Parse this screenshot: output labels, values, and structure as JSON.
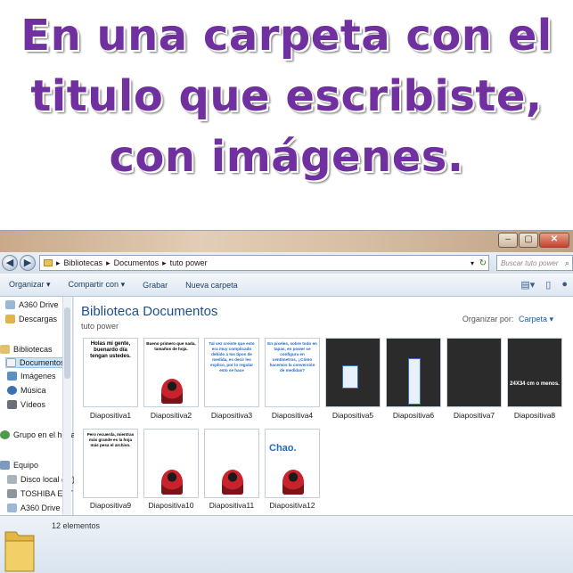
{
  "headline": "En una carpeta con el titulo que escribiste, con imágenes.",
  "window": {
    "controls": [
      "–",
      "▢",
      "✕"
    ]
  },
  "address": {
    "breadcrumbs": [
      "Bibliotecas",
      "Documentos",
      "tuto power"
    ],
    "search_placeholder": "Buscar tuto power"
  },
  "toolbar": {
    "organize": "Organizar ▾",
    "share": "Compartir con ▾",
    "burn": "Grabar",
    "new_folder": "Nueva carpeta"
  },
  "nav": {
    "items": [
      {
        "label": "A360 Drive"
      },
      {
        "label": "Descargas"
      },
      {
        "label": "Bibliotecas"
      },
      {
        "label": "Documentos"
      },
      {
        "label": "Imágenes"
      },
      {
        "label": "Música"
      },
      {
        "label": "Vídeos"
      },
      {
        "label": "Grupo en el hogar"
      },
      {
        "label": "Equipo"
      },
      {
        "label": "Disco local (C:)"
      },
      {
        "label": "TOSHIBA EXT ("
      },
      {
        "label": "A360 Drive"
      }
    ]
  },
  "library": {
    "title": "Biblioteca Documentos",
    "subtitle": "tuto power",
    "arrange_label": "Organizar por:",
    "arrange_value": "Carpeta ▾"
  },
  "files": [
    {
      "name": "Diapositiva1",
      "text": "Holas mi gente, buenardo día tengan ustedes."
    },
    {
      "name": "Diapositiva2",
      "text": "Bueno primero que nada, tamaños de hoja."
    },
    {
      "name": "Diapositiva3",
      "text": "Tal vez creiste que esto era muy complicado debido a los tipos de medida, es decir les explico, por lo regular esto se hace"
    },
    {
      "name": "Diapositiva4",
      "text": "En pixeles, sobre todo en tapas, en power se configura en centímetros, ¿Cómo hacemos la conversión de medidas?"
    },
    {
      "name": "Diapositiva5",
      "text": ""
    },
    {
      "name": "Diapositiva6",
      "text": ""
    },
    {
      "name": "Diapositiva7",
      "text": ""
    },
    {
      "name": "Diapositiva8",
      "text": "24X34 cm o menos."
    },
    {
      "name": "Diapositiva9",
      "text": "Pero recuerda, mientras más grande es la hoja más pesa el archivo."
    },
    {
      "name": "Diapositiva10",
      "text": ""
    },
    {
      "name": "Diapositiva11",
      "text": ""
    },
    {
      "name": "Diapositiva12",
      "text": "Chao."
    }
  ],
  "status": {
    "count": "12 elementos"
  },
  "colors": {
    "headline": "#7030a0",
    "link_blue": "#1e4f8c",
    "thumb_red": "#d42a1e"
  }
}
